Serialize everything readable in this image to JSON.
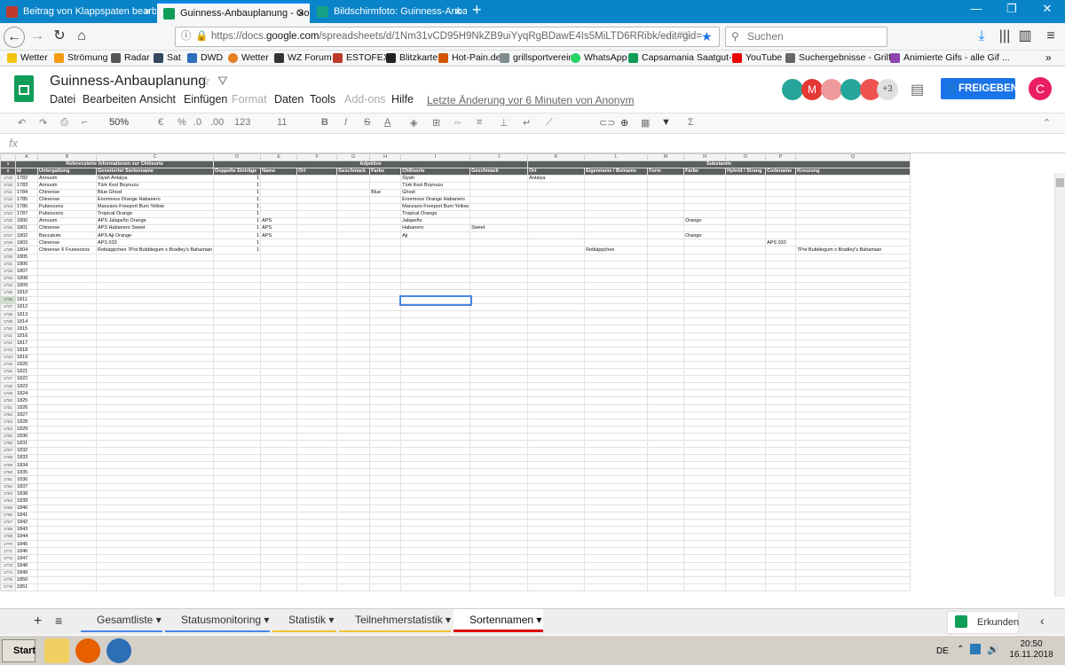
{
  "browser": {
    "tabs": [
      {
        "title": "Beitrag von Klappspaten bearbeite",
        "color": "#c0392b"
      },
      {
        "title": "Guinness-Anbauplanung - Google",
        "color": "#0f9d58"
      },
      {
        "title": "Bildschirmfoto: Guinness-Anbaupl",
        "color": "#16a085"
      }
    ],
    "url_prefix": "https://docs.",
    "url_domain": "google.com",
    "url_rest": "/spreadsheets/d/1Nm31vCD95H9NkZB9uiYyqRgBDawE4Is5MiLTD6RRibk/edit#gid=",
    "search_placeholder": "Suchen",
    "bookmarks": [
      "Wetter",
      "Strömung",
      "Radar",
      "Sat",
      "DWD",
      "Wetter",
      "WZ Forum",
      "ESTOFEX",
      "Blitzkarte",
      "Hot-Pain.de",
      "grillsportverein",
      "WhatsApp",
      "Capsamania Saatgut- ...",
      "YouTube",
      "Suchergebnisse - Grilf...",
      "Animierte Gifs - alle Gif ..."
    ]
  },
  "docs": {
    "title": "Guinness-Anbauplanung",
    "menu": [
      "Datei",
      "Bearbeiten",
      "Ansicht",
      "Einfügen",
      "Format",
      "Daten",
      "Tools",
      "Add-ons",
      "Hilfe"
    ],
    "last_edit": "Letzte Änderung vor 6 Minuten von Anonym",
    "share_label": "FREIGEBEN",
    "avatar_letter": "C",
    "collab_more": "+3",
    "collab_m": "M",
    "zoom": "50%",
    "currency": "€",
    "percent": "%",
    "dec1": ".0",
    "dec2": ".00",
    "numfmt": "123",
    "fontsize": "11",
    "fx": "fx"
  },
  "sheet": {
    "columns": [
      "A",
      "B",
      "C",
      "D",
      "E",
      "F",
      "G",
      "H",
      "I",
      "J",
      "K",
      "L",
      "M",
      "N",
      "O",
      "P",
      "Q"
    ],
    "header_group": {
      "left": "Referenzierte Informationen zur Chilisorte",
      "mid": "Adjektive",
      "right": "Substantiv"
    },
    "header_cols": [
      "Id",
      "Untergattung",
      "Generierter Sortenname",
      "Doppelte Einträge",
      "Name",
      "Ort",
      "Geschmack",
      "Farbe",
      "Chilisorte",
      "Geschmack",
      "Ort",
      "Eigenname / Beiname",
      "Form",
      "Farbe",
      "Hybrid / Strang",
      "Codename",
      "Kreuzung"
    ],
    "rows": [
      {
        "rn": "1719",
        "id": "1782",
        "b": "Annuum",
        "c": "Siyah Antalya",
        "d": "1",
        "e": "",
        "h": "",
        "i": "Siyah",
        "j": "",
        "k": "Antalya",
        "l": "",
        "n": "",
        "p": "",
        "q": ""
      },
      {
        "rn": "1720",
        "id": "1783",
        "b": "Annuum",
        "c": "Türk Kezi Boynuzu",
        "d": "1",
        "e": "",
        "h": "",
        "i": "Türk Kezi Boynuzu",
        "j": "",
        "k": "",
        "l": "",
        "n": "",
        "p": "",
        "q": ""
      },
      {
        "rn": "1721",
        "id": "1784",
        "b": "Chinense",
        "c": "Blue Ghost",
        "d": "1",
        "e": "",
        "h": "Blue",
        "i": "Ghost",
        "j": "",
        "k": "",
        "l": "",
        "n": "",
        "p": "",
        "q": ""
      },
      {
        "rn": "1722",
        "id": "1785",
        "b": "Chinense",
        "c": "Enormous Orange Habanero",
        "d": "1",
        "e": "",
        "h": "",
        "i": "Enormous Orange Habanero",
        "j": "",
        "k": "",
        "l": "",
        "n": "",
        "p": "",
        "q": ""
      },
      {
        "rn": "1723",
        "id": "1786",
        "b": "Pubescens",
        "c": "Manzano Freeport Bum Yellow",
        "d": "1",
        "e": "",
        "h": "",
        "i": "Manzano Freeport Bum Yellow",
        "j": "",
        "k": "",
        "l": "",
        "n": "",
        "p": "",
        "q": ""
      },
      {
        "rn": "1724",
        "id": "1787",
        "b": "Pubescens",
        "c": "Tropical Orange",
        "d": "1",
        "e": "",
        "h": "",
        "i": "Tropical Orange",
        "j": "",
        "k": "",
        "l": "",
        "n": "",
        "p": "",
        "q": ""
      },
      {
        "rn": "1725",
        "id": "1800",
        "b": "Annuum",
        "c": "APS Jalapeño Orange",
        "d": "1",
        "e": "APS",
        "h": "",
        "i": "Jalapeño",
        "j": "",
        "k": "",
        "l": "",
        "n": "Orange",
        "p": "",
        "q": ""
      },
      {
        "rn": "1726",
        "id": "1801",
        "b": "Chinense",
        "c": "APS Habanero Sweet",
        "d": "1",
        "e": "APS",
        "h": "",
        "i": "Habanero",
        "j": "Sweet",
        "k": "",
        "l": "",
        "n": "",
        "p": "",
        "q": ""
      },
      {
        "rn": "1727",
        "id": "1802",
        "b": "Baccatum",
        "c": "APS Aji Orange",
        "d": "1",
        "e": "APS",
        "h": "",
        "i": "Aji",
        "j": "",
        "k": "",
        "l": "",
        "n": "Orange",
        "p": "",
        "q": ""
      },
      {
        "rn": "1728",
        "id": "1803",
        "b": "Chinense",
        "c": "APS 033",
        "d": "1",
        "e": "",
        "h": "",
        "i": "",
        "j": "",
        "k": "",
        "l": "",
        "n": "",
        "p": "APS 033",
        "q": ""
      },
      {
        "rn": "1729",
        "id": "1804",
        "b": "Chinense X Frutescens",
        "c": "Rotkäppchen 7Pot Bubblegum x Bradley's Bahamian",
        "d": "1",
        "e": "",
        "h": "",
        "i": "",
        "j": "",
        "k": "",
        "l": "Rotkäppchen",
        "n": "",
        "p": "",
        "q": "7Pot Bubblegum x Bradley's Bahamian"
      }
    ],
    "empty_ids": [
      "1805",
      "1806",
      "1807",
      "1808",
      "1809",
      "1810",
      "1811",
      "1812",
      "1813",
      "1814",
      "1815",
      "1816",
      "1817",
      "1818",
      "1819",
      "1820",
      "1821",
      "1822",
      "1823",
      "1824",
      "1825",
      "1826",
      "1827",
      "1828",
      "1829",
      "1830",
      "1831",
      "1832",
      "1833",
      "1834",
      "1835",
      "1836",
      "1837",
      "1838",
      "1839",
      "1840",
      "1841",
      "1842",
      "1843",
      "1844",
      "1845",
      "1846",
      "1847",
      "1848",
      "1849",
      "1850",
      "1851"
    ],
    "empty_row_start": 1730
  },
  "sheet_tabs": [
    "Gesamtliste",
    "Statusmonitoring",
    "Statistik",
    "Teilnehmerstatistik",
    "Sortennamen"
  ],
  "explore_label": "Erkunden",
  "taskbar": {
    "start": "Start",
    "lang": "DE",
    "time": "20:50",
    "date": "16.11.2018"
  }
}
